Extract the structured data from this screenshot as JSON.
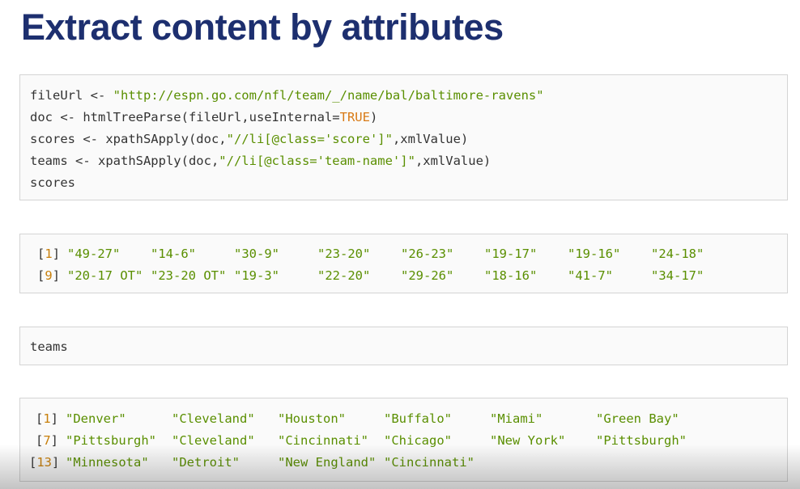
{
  "title": "Extract content by attributes",
  "code": {
    "line1": {
      "pre": "fileUrl <- ",
      "str": "\"http://espn.go.com/nfl/team/_/name/bal/baltimore-ravens\""
    },
    "line2": {
      "pre": "doc <- htmlTreeParse(fileUrl,useInternal=",
      "kw": "TRUE",
      "post": ")"
    },
    "line3": {
      "pre": "scores <- xpathSApply(doc,",
      "str": "\"//li[@class='score']\"",
      "post": ",xmlValue)"
    },
    "line4": {
      "pre": "teams <- xpathSApply(doc,",
      "str": "\"//li[@class='team-name']\"",
      "post": ",xmlValue)"
    },
    "line5": "scores"
  },
  "scores_output": {
    "rows": [
      {
        "index": "1",
        "values": [
          "\"49-27\"",
          "\"14-6\"",
          "\"30-9\"",
          "\"23-20\"",
          "\"26-23\"",
          "\"19-17\"",
          "\"19-16\"",
          "\"24-18\""
        ]
      },
      {
        "index": "9",
        "values": [
          "\"20-17 OT\"",
          "\"23-20 OT\"",
          "\"19-3\"",
          "\"22-20\"",
          "\"29-26\"",
          "\"18-16\"",
          "\"41-7\"",
          "\"34-17\""
        ]
      }
    ]
  },
  "teams_command": "teams",
  "teams_output": {
    "rows": [
      {
        "index": "1",
        "values": [
          "\"Denver\"",
          "\"Cleveland\"",
          "\"Houston\"",
          "\"Buffalo\"",
          "\"Miami\"",
          "\"Green Bay\""
        ]
      },
      {
        "index": "7",
        "values": [
          "\"Pittsburgh\"",
          "\"Cleveland\"",
          "\"Cincinnati\"",
          "\"Chicago\"",
          "\"New York\"",
          "\"Pittsburgh\""
        ]
      },
      {
        "index": "13",
        "values": [
          "\"Minnesota\"",
          "\"Detroit\"",
          "\"New England\"",
          "\"Cincinnati\""
        ]
      }
    ]
  },
  "colors": {
    "title": "#1d2f6f",
    "string": "#5a8f00",
    "keyword": "#d87a15",
    "index": "#c87f0a"
  }
}
